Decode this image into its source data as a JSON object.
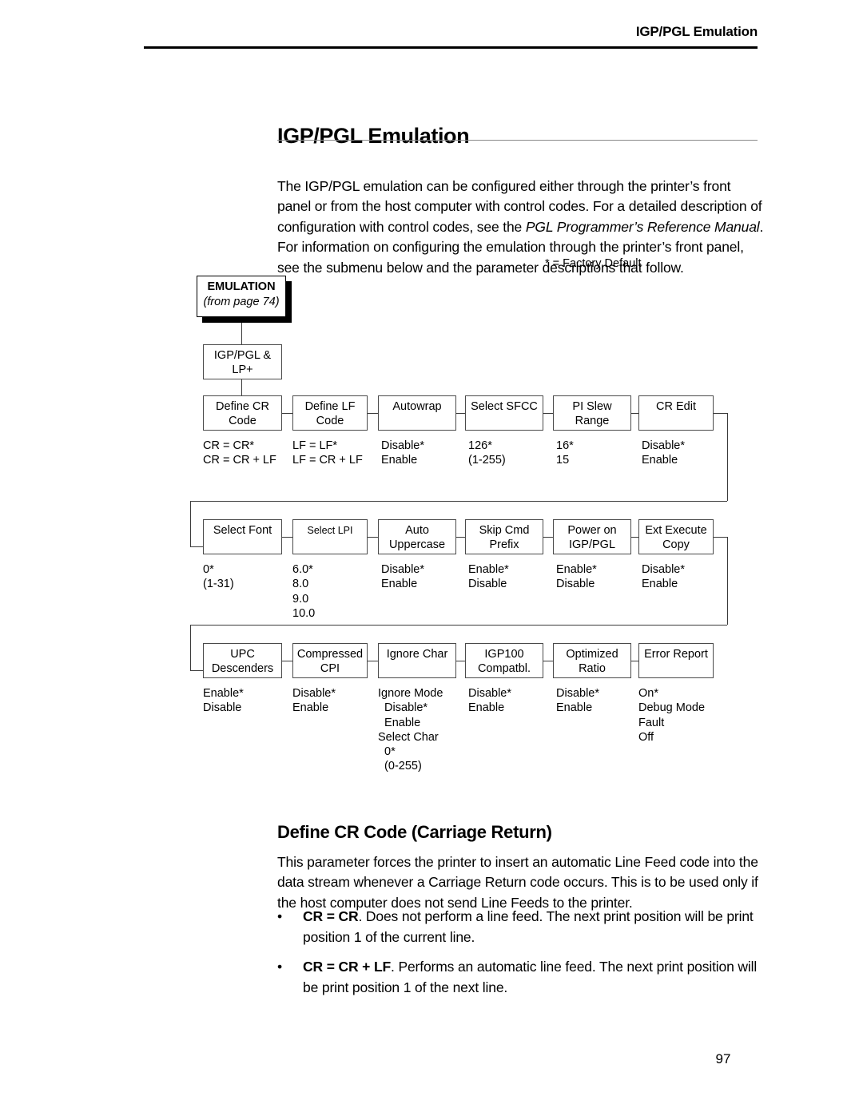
{
  "header": {
    "running_head": "IGP/PGL Emulation"
  },
  "page_title": "IGP/PGL Emulation",
  "intro": {
    "part1": "The IGP/PGL emulation can be configured either through the printer’s front panel or from the host computer with control codes. For a detailed description of configuration with control codes, see the ",
    "italic1": "PGL Programmer’s Reference Manual",
    "part2": ". For information on configuring the emulation through the printer’s front panel, see the submenu below and the parameter descriptions that follow."
  },
  "flowchart": {
    "factory_default_note": "* = Factory Default",
    "root": {
      "title": "EMULATION",
      "subtitle": "(from page 74)"
    },
    "submenu": {
      "line1": "IGP/PGL &",
      "line2": "LP+"
    },
    "rows": [
      {
        "items": [
          {
            "label_line1": "Define CR",
            "label_line2": "Code",
            "options": [
              "CR = CR*",
              "CR = CR + LF"
            ]
          },
          {
            "label_line1": "Define LF",
            "label_line2": "Code",
            "options": [
              "LF = LF*",
              "LF = CR + LF"
            ]
          },
          {
            "label_line1": "Autowrap",
            "label_line2": "",
            "options": [
              "Disable*",
              "Enable"
            ]
          },
          {
            "label_line1": "Select SFCC",
            "label_line2": "",
            "options": [
              "126*",
              "(1-255)"
            ]
          },
          {
            "label_line1": "PI Slew",
            "label_line2": "Range",
            "options": [
              "16*",
              "15"
            ]
          },
          {
            "label_line1": "CR Edit",
            "label_line2": "",
            "options": [
              "Disable*",
              "Enable"
            ]
          }
        ]
      },
      {
        "items": [
          {
            "label_line1": "Select Font",
            "label_line2": "",
            "options": [
              "0*",
              "(1-31)"
            ]
          },
          {
            "label_line1": "Select LPI",
            "label_line2": "",
            "small": true,
            "options": [
              "6.0*",
              "8.0",
              "9.0",
              "10.0"
            ]
          },
          {
            "label_line1": "Auto",
            "label_line2": "Uppercase",
            "options": [
              "Disable*",
              "Enable"
            ]
          },
          {
            "label_line1": "Skip Cmd",
            "label_line2": "Prefix",
            "options": [
              "Enable*",
              "Disable"
            ]
          },
          {
            "label_line1": "Power on",
            "label_line2": "IGP/PGL",
            "options": [
              "Enable*",
              "Disable"
            ]
          },
          {
            "label_line1": "Ext Execute",
            "label_line2": "Copy",
            "options": [
              "Disable*",
              "Enable"
            ]
          }
        ]
      },
      {
        "items": [
          {
            "label_line1": "UPC",
            "label_line2": "Descenders",
            "options": [
              "Enable*",
              "Disable"
            ]
          },
          {
            "label_line1": "Compressed",
            "label_line2": "CPI",
            "options": [
              "Disable*",
              "Enable"
            ]
          },
          {
            "label_line1": "Ignore Char",
            "label_line2": "",
            "options": [
              "Ignore Mode",
              "  Disable*",
              "  Enable",
              "Select Char",
              "  0*",
              "  (0-255)"
            ]
          },
          {
            "label_line1": "IGP100",
            "label_line2": "Compatbl.",
            "options": [
              "Disable*",
              "Enable"
            ]
          },
          {
            "label_line1": "Optimized",
            "label_line2": "Ratio",
            "options": [
              "Disable*",
              "Enable"
            ]
          },
          {
            "label_line1": "Error Report",
            "label_line2": "",
            "options": [
              "On*",
              "Debug Mode",
              "Fault",
              "Off"
            ]
          }
        ]
      }
    ]
  },
  "section": {
    "heading": "Define CR Code (Carriage Return)",
    "body": "This parameter forces the printer to insert an automatic Line Feed code into the data stream whenever a Carriage Return code occurs. This is to be used only if the host computer does not send Line Feeds to the printer.",
    "bullet_char": "•",
    "bullets": [
      {
        "term": "CR = CR",
        "rest": ". Does not perform a line feed. The next print position will be print position 1 of the current line."
      },
      {
        "term": "CR = CR + LF",
        "rest": ". Performs an automatic line feed. The next print position will be print position 1 of the next line."
      }
    ]
  },
  "page_number": "97"
}
